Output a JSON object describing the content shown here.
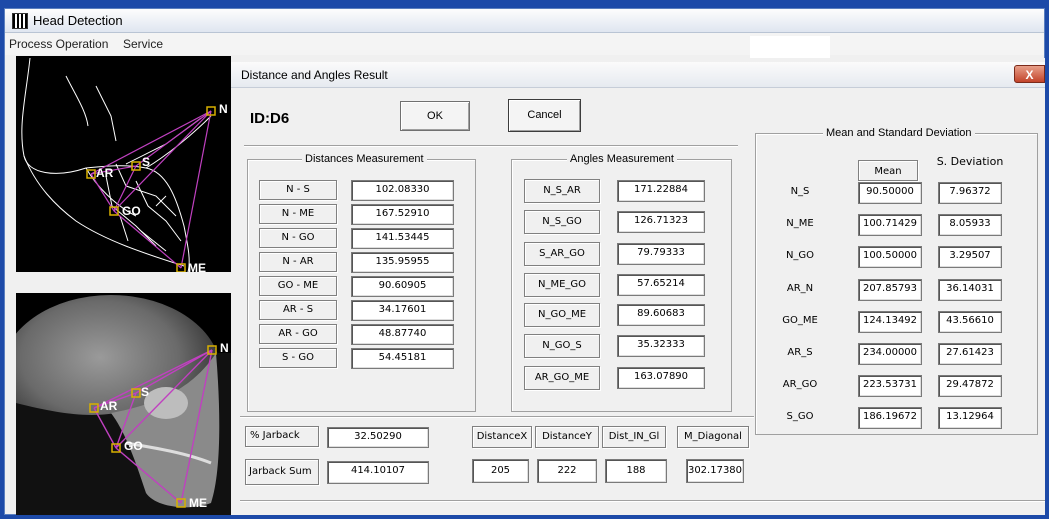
{
  "app": {
    "title": "Head Detection",
    "menu": [
      "Process Operation",
      "Service"
    ]
  },
  "dialog": {
    "title": "Distance and Angles Result",
    "id_label": "ID:D6",
    "ok": "OK",
    "cancel": "Cancel",
    "close": "X"
  },
  "image_labels": {
    "n": "N",
    "s": "S",
    "ar": "AR",
    "go": "GO",
    "me": "ME"
  },
  "distances": {
    "title": "Distances Measurement",
    "rows": [
      {
        "label": "N - S",
        "value": "102.08330"
      },
      {
        "label": "N - ME",
        "value": "167.52910"
      },
      {
        "label": "N - GO",
        "value": "141.53445"
      },
      {
        "label": "N - AR",
        "value": "135.95955"
      },
      {
        "label": "GO - ME",
        "value": "90.60905"
      },
      {
        "label": "AR - S",
        "value": "34.17601"
      },
      {
        "label": "AR - GO",
        "value": "48.87740"
      },
      {
        "label": "S - GO",
        "value": "54.45181"
      }
    ]
  },
  "angles": {
    "title": "Angles Measurement",
    "rows": [
      {
        "label": "N_S_AR",
        "value": "171.22884"
      },
      {
        "label": "N_S_GO",
        "value": "126.71323"
      },
      {
        "label": "S_AR_GO",
        "value": "79.79333"
      },
      {
        "label": "N_ME_GO",
        "value": "57.65214"
      },
      {
        "label": "N_GO_ME",
        "value": "89.60683"
      },
      {
        "label": "N_GO_S",
        "value": "35.32333"
      },
      {
        "label": "AR_GO_ME",
        "value": "163.07890"
      }
    ]
  },
  "stats": {
    "title": "Mean and Standard Deviation",
    "mean_header": "Mean",
    "sd_header": "S. Deviation",
    "rows": [
      {
        "label": "N_S",
        "mean": "90.50000",
        "sd": "7.96372"
      },
      {
        "label": "N_ME",
        "mean": "100.71429",
        "sd": "8.05933"
      },
      {
        "label": "N_GO",
        "mean": "100.50000",
        "sd": "3.29507"
      },
      {
        "label": "AR_N",
        "mean": "207.85793",
        "sd": "36.14031"
      },
      {
        "label": "GO_ME",
        "mean": "124.13492",
        "sd": "43.56610"
      },
      {
        "label": "AR_S",
        "mean": "234.00000",
        "sd": "27.61423"
      },
      {
        "label": "AR_GO",
        "mean": "223.53731",
        "sd": "29.47872"
      },
      {
        "label": "S_GO",
        "mean": "186.19672",
        "sd": "13.12964"
      }
    ]
  },
  "jarback": {
    "percent_label": "% Jarback",
    "percent_value": "32.50290",
    "sum_label": "Jarback Sum",
    "sum_value": "414.10107"
  },
  "extra": {
    "headers": [
      "DistanceX",
      "DistanceY",
      "Dist_IN_Gl",
      "M_Diagonal"
    ],
    "values": [
      "205",
      "222",
      "188",
      "302.17380"
    ]
  }
}
